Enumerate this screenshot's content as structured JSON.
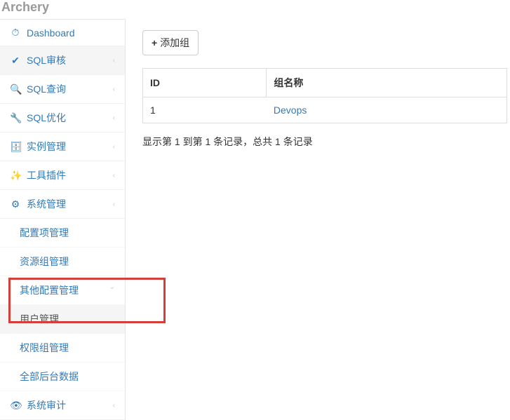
{
  "app": {
    "title": "Archery"
  },
  "sidebar": {
    "items": {
      "dashboard": "Dashboard",
      "sqlaudit": "SQL审核",
      "sqlquery": "SQL查询",
      "sqloptimize": "SQL优化",
      "instance": "实例管理",
      "plugin": "工具插件",
      "system": "系统管理",
      "systemaudit": "系统审计"
    },
    "sub": {
      "config": "配置项管理",
      "resourcegroup": "资源组管理",
      "otherconfig": "其他配置管理",
      "usermgmt": "用户管理",
      "permgroup": "权限组管理",
      "allbackend": "全部后台数据"
    }
  },
  "toolbar": {
    "addgroup": "添加组"
  },
  "table": {
    "header_id": "ID",
    "header_name": "组名称",
    "row0_id": "1",
    "row0_name": "Devops"
  },
  "footer": {
    "info": "显示第 1 到第 1 条记录，总共 1 条记录"
  }
}
